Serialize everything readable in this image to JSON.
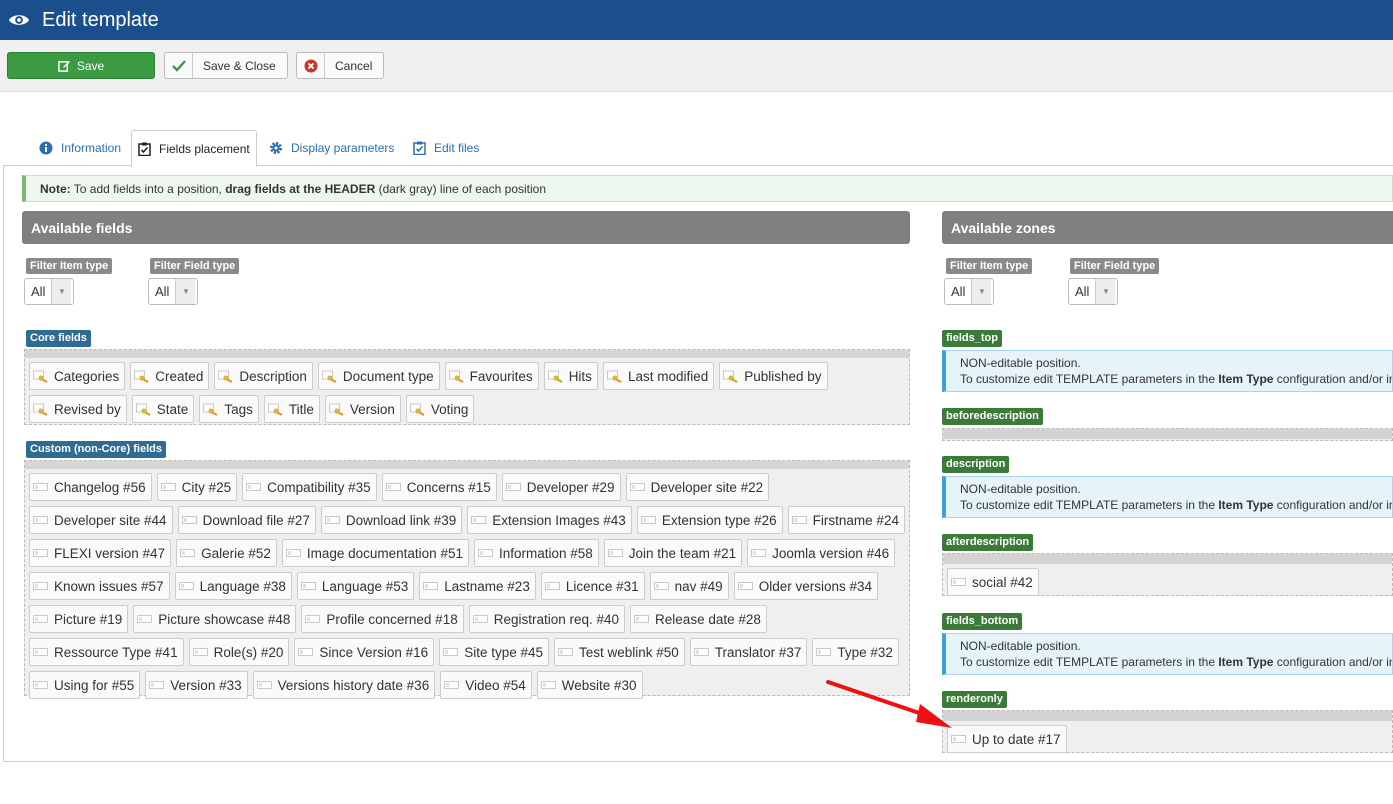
{
  "header": {
    "title": "Edit template"
  },
  "toolbar": {
    "save": "Save",
    "save_close": "Save & Close",
    "cancel": "Cancel"
  },
  "tabs": [
    {
      "label": "Information",
      "active": false
    },
    {
      "label": "Fields placement",
      "active": true
    },
    {
      "label": "Display parameters",
      "active": false
    },
    {
      "label": "Edit files",
      "active": false
    }
  ],
  "note": {
    "prefix": "Note:",
    "text1": " To add fields into a position, ",
    "bold": "drag fields at the HEADER",
    "text2": " (dark gray) line of each position"
  },
  "available_fields": {
    "title": "Available fields",
    "filter_item_type": {
      "label": "Filter Item type",
      "value": "All"
    },
    "filter_field_type": {
      "label": "Filter Field type",
      "value": "All"
    },
    "core_label": "Core fields",
    "core": [
      "Categories",
      "Created",
      "Description",
      "Document type",
      "Favourites",
      "Hits",
      "Last modified",
      "Published by",
      "Revised by",
      "State",
      "Tags",
      "Title",
      "Version",
      "Voting"
    ],
    "custom_label": "Custom (non-Core) fields",
    "custom": [
      "Changelog #56",
      "City #25",
      "Compatibility #35",
      "Concerns #15",
      "Developer #29",
      "Developer site #22",
      "Developer site #44",
      "Download file #27",
      "Download link #39",
      "Extension Images #43",
      "Extension type #26",
      "Firstname #24",
      "FLEXI version #47",
      "Galerie #52",
      "Image documentation #51",
      "Information #58",
      "Join the team #21",
      "Joomla version #46",
      "Known issues #57",
      "Language #38",
      "Language #53",
      "Lastname #23",
      "Licence #31",
      "nav #49",
      "Older versions #34",
      "Picture #19",
      "Picture showcase #48",
      "Profile concerned #18",
      "Registration req. #40",
      "Release date #28",
      "Ressource Type #41",
      "Role(s) #20",
      "Since Version #16",
      "Site type #45",
      "Test weblink #50",
      "Translator #37",
      "Type #32",
      "Using for #55",
      "Version #33",
      "Versions history date #36",
      "Video #54",
      "Website #30"
    ]
  },
  "available_zones": {
    "title": "Available zones",
    "filter_item_type": {
      "label": "Filter Item type",
      "value": "All"
    },
    "filter_field_type": {
      "label": "Filter Field type",
      "value": "All"
    },
    "noneditable": {
      "line1": "NON-editable position.",
      "line2a": "To customize edit TEMPLATE parameters in the ",
      "line2b": "Item Type",
      "line2c": " configuration and/or in"
    },
    "zones": {
      "fields_top": "fields_top",
      "beforedescription": "beforedescription",
      "description": "description",
      "afterdescription": "afterdescription",
      "fields_bottom": "fields_bottom",
      "renderonly": "renderonly"
    },
    "afterdescription_fields": [
      "social #42"
    ],
    "renderonly_fields": [
      "Up to date #17"
    ]
  }
}
